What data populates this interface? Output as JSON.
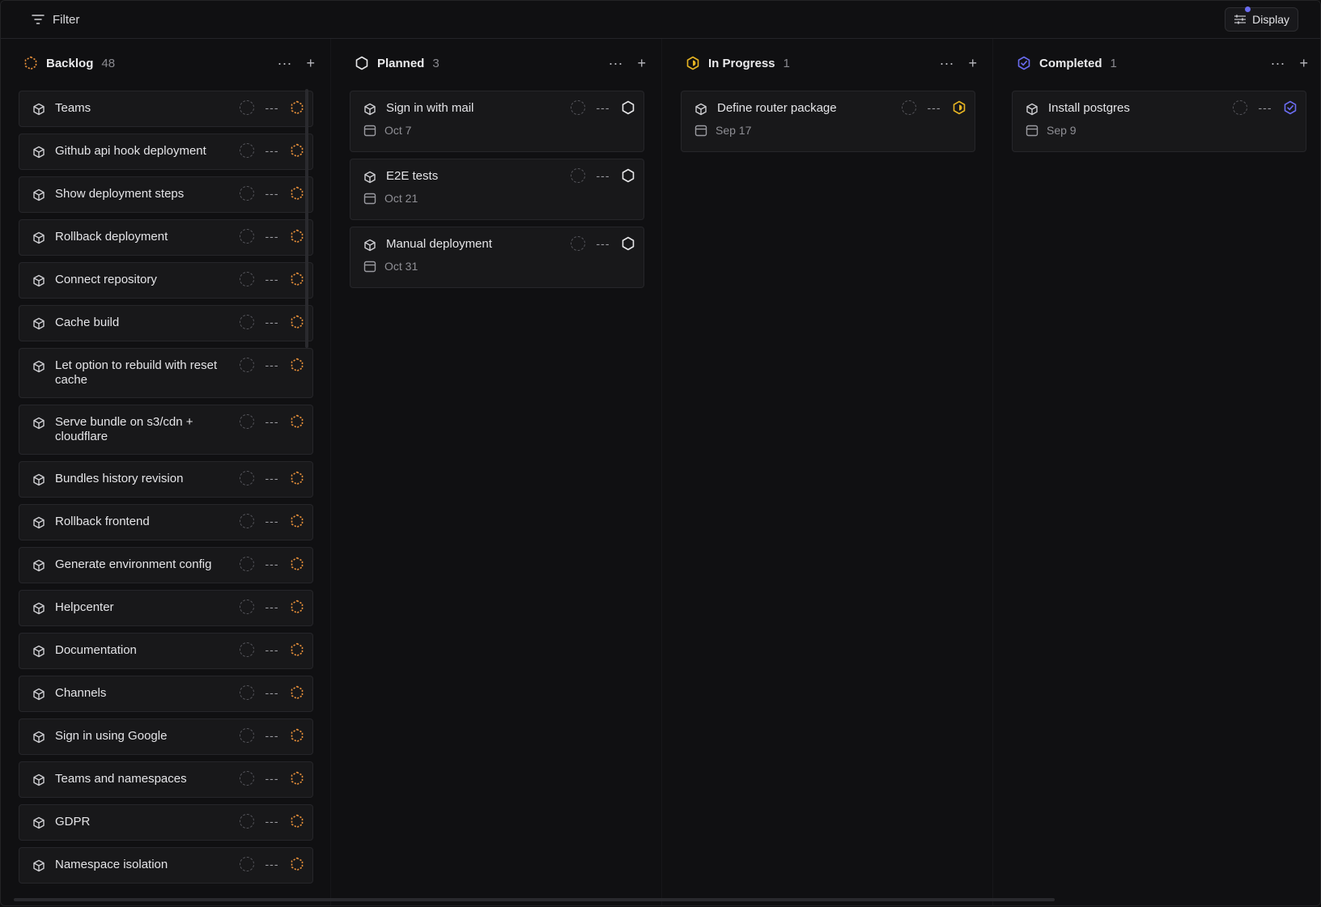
{
  "toolbar": {
    "filter_label": "Filter",
    "display_label": "Display"
  },
  "colors": {
    "backlog": "#e8903a",
    "planned": "#e6e6e8",
    "in_progress": "#e6b422",
    "completed": "#6a6cf0"
  },
  "columns": [
    {
      "title": "Backlog",
      "count": "48",
      "status_icon": "backlog-dashed-hexagon-icon",
      "cards": [
        {
          "title": "Teams"
        },
        {
          "title": "Github api hook deployment"
        },
        {
          "title": "Show deployment steps"
        },
        {
          "title": "Rollback deployment"
        },
        {
          "title": "Connect repository"
        },
        {
          "title": "Cache build"
        },
        {
          "title": "Let option to rebuild with reset cache"
        },
        {
          "title": "Serve bundle on s3/cdn + cloudflare"
        },
        {
          "title": "Bundles history revision"
        },
        {
          "title": "Rollback frontend"
        },
        {
          "title": "Generate environment config"
        },
        {
          "title": "Helpcenter"
        },
        {
          "title": "Documentation"
        },
        {
          "title": "Channels"
        },
        {
          "title": "Sign in using Google"
        },
        {
          "title": "Teams and namespaces"
        },
        {
          "title": "GDPR"
        },
        {
          "title": "Namespace isolation"
        }
      ]
    },
    {
      "title": "Planned",
      "count": "3",
      "status_icon": "planned-hexagon-icon",
      "cards": [
        {
          "title": "Sign in with mail",
          "date": "Oct 7"
        },
        {
          "title": "E2E tests",
          "date": "Oct 21"
        },
        {
          "title": "Manual deployment",
          "date": "Oct 31"
        }
      ]
    },
    {
      "title": "In Progress",
      "count": "1",
      "status_icon": "in-progress-hexagon-icon",
      "cards": [
        {
          "title": "Define router package",
          "date": "Sep 17"
        }
      ]
    },
    {
      "title": "Completed",
      "count": "1",
      "status_icon": "completed-check-hexagon-icon",
      "cards": [
        {
          "title": "Install postgres",
          "date": "Sep 9"
        }
      ]
    }
  ]
}
